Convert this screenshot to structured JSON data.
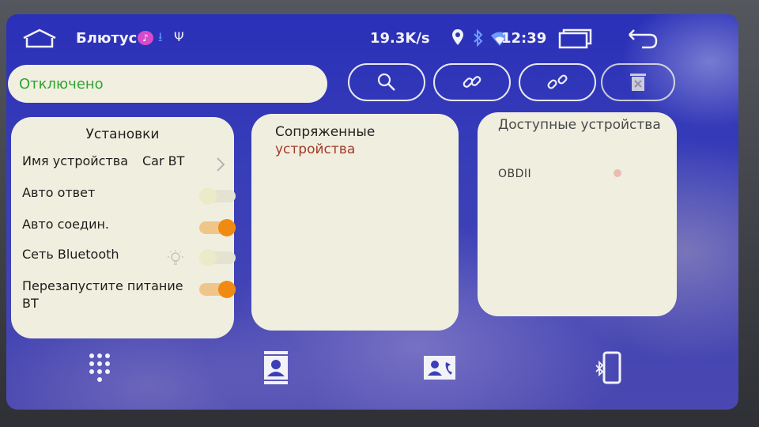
{
  "status_bar": {
    "app_title": "Блютус",
    "net_speed": "19.3K/s",
    "time": "12:39"
  },
  "status_field": {
    "text": "Отключено"
  },
  "settings": {
    "title": "Установки",
    "device_name_label": "Имя устройства",
    "device_name_value": "Car BT",
    "auto_answer_label": "Авто ответ",
    "auto_answer_on": false,
    "auto_connect_label": "Авто соедин.",
    "auto_connect_on": true,
    "bt_network_label": "Сеть Bluetooth",
    "bt_network_on": false,
    "restart_power_label_line1": "Перезапустите питание",
    "restart_power_label_line2": "BT",
    "restart_power_on": true
  },
  "paired": {
    "title_line1": "Сопряженные",
    "title_line2": "устройства",
    "devices": []
  },
  "available": {
    "title": "Доступные устройства",
    "devices": [
      "OBDII"
    ]
  },
  "icons": {
    "home": "home-icon",
    "music": "music-note-icon",
    "download": "download-icon",
    "usb": "usb-icon",
    "location": "location-pin-icon",
    "bluetooth": "bluetooth-icon",
    "wifi": "wifi-icon",
    "recents": "recents-icon",
    "back": "back-arrow-icon",
    "search": "search-icon",
    "connect": "link-icon",
    "disconnect": "unlink-icon",
    "delete": "trash-icon",
    "dialpad": "dialpad-icon",
    "contacts": "contacts-icon",
    "call_log": "call-log-icon",
    "phone": "phone-bluetooth-icon"
  },
  "colors": {
    "status_text": "#2fa32f",
    "toggle_on": "#f08a12",
    "panel_bg": "#f0efdf",
    "screen_bg": "#2a30b8"
  }
}
